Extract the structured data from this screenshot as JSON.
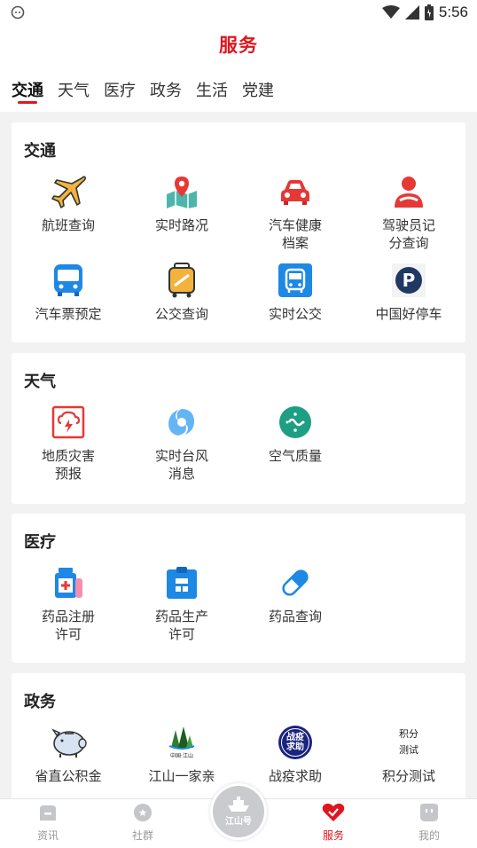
{
  "status_bar": {
    "time": "5:56"
  },
  "header": {
    "title": "服务"
  },
  "tabs": [
    {
      "label": "交通",
      "active": true
    },
    {
      "label": "天气"
    },
    {
      "label": "医疗"
    },
    {
      "label": "政务"
    },
    {
      "label": "生活"
    },
    {
      "label": "党建"
    }
  ],
  "sections": {
    "traffic": {
      "title": "交通",
      "items": [
        {
          "label": "航班查询",
          "icon": "airplane-icon"
        },
        {
          "label": "实时路况",
          "icon": "map-pin-icon"
        },
        {
          "label": "汽车健康\n档案",
          "icon": "car-icon"
        },
        {
          "label": "驾驶员记\n分查询",
          "icon": "driver-icon"
        },
        {
          "label": "汽车票预定",
          "icon": "bus-icon"
        },
        {
          "label": "公交查询",
          "icon": "luggage-icon"
        },
        {
          "label": "实时公交",
          "icon": "bus-front-icon"
        },
        {
          "label": "中国好停车",
          "icon": "parking-icon"
        }
      ]
    },
    "weather": {
      "title": "天气",
      "items": [
        {
          "label": "地质灾害\n预报",
          "icon": "disaster-icon"
        },
        {
          "label": "实时台风\n消息",
          "icon": "typhoon-icon"
        },
        {
          "label": "空气质量",
          "icon": "air-quality-icon"
        }
      ]
    },
    "medical": {
      "title": "医疗",
      "items": [
        {
          "label": "药品注册\n许可",
          "icon": "medicine-bottle-icon"
        },
        {
          "label": "药品生产\n许可",
          "icon": "clipboard-icon"
        },
        {
          "label": "药品查询",
          "icon": "pill-icon"
        }
      ]
    },
    "government": {
      "title": "政务",
      "items": [
        {
          "label": "省直公积金",
          "icon": "piggy-bank-icon"
        },
        {
          "label": "江山一家亲",
          "icon": "jiangshan-logo-icon",
          "logo_text": "中国·江山"
        },
        {
          "label": "战疫求助",
          "icon": "epidemic-help-icon",
          "badge_text": "战疫\n求助"
        },
        {
          "label": "积分测试",
          "icon": "points-test-icon",
          "badge_text": "积分\n测试"
        }
      ]
    }
  },
  "bottom_nav": {
    "items": [
      {
        "label": "资讯",
        "icon": "news-icon"
      },
      {
        "label": "社群",
        "icon": "community-icon"
      },
      {
        "label": "服务",
        "icon": "heart-icon",
        "active": true
      },
      {
        "label": "我的",
        "icon": "profile-icon"
      }
    ],
    "center_label": "江山号"
  },
  "colors": {
    "accent": "#e0161e",
    "inactive": "#999999",
    "icon_blue": "#1e88e5"
  }
}
